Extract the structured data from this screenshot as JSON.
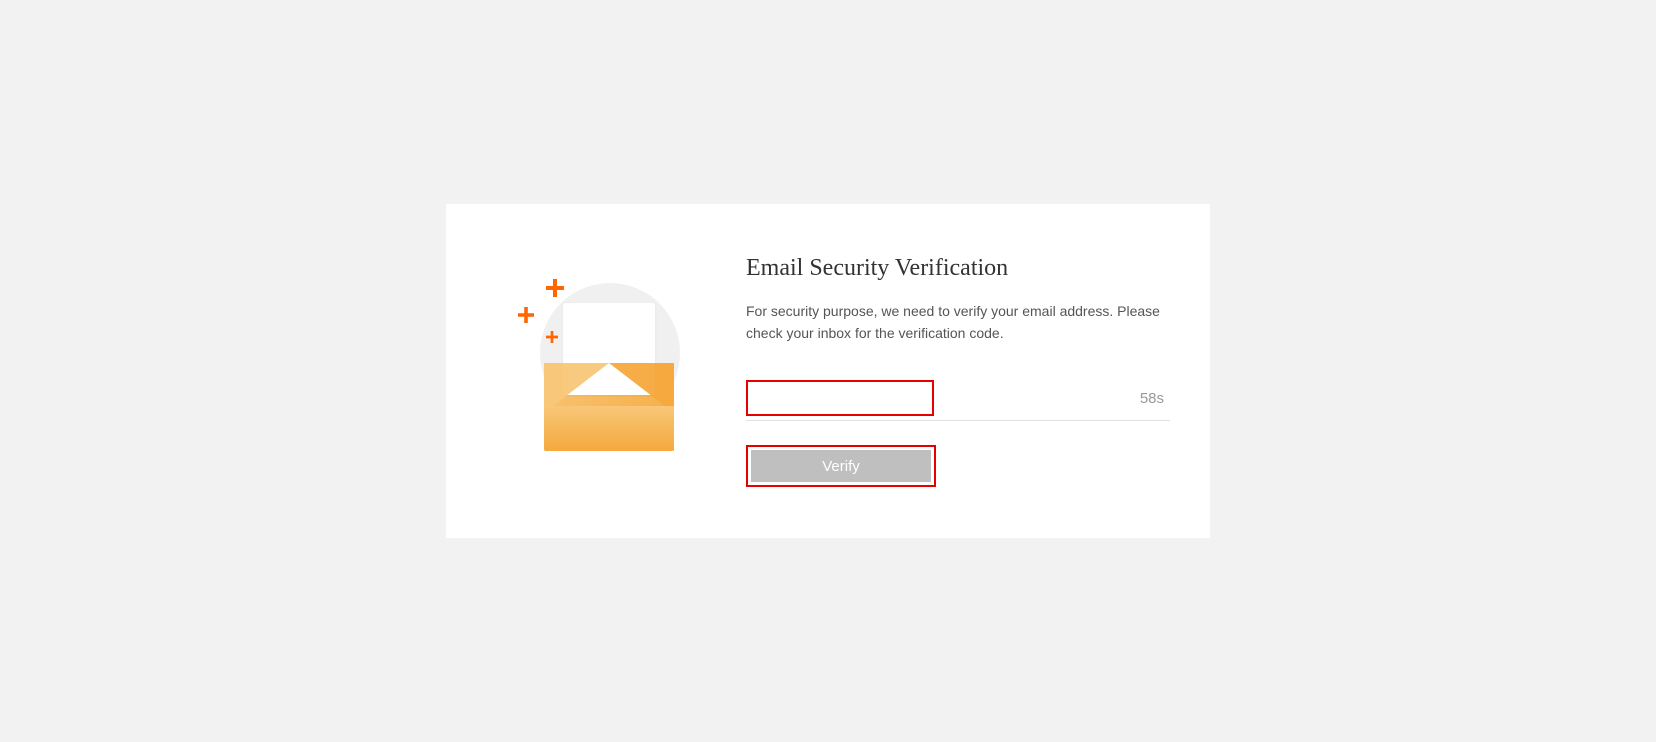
{
  "title": "Email Security Verification",
  "description": "For security purpose, we need to verify your email address. Please check your inbox for the verification code.",
  "timer": "58s",
  "verify_label": "Verify",
  "code_value": ""
}
